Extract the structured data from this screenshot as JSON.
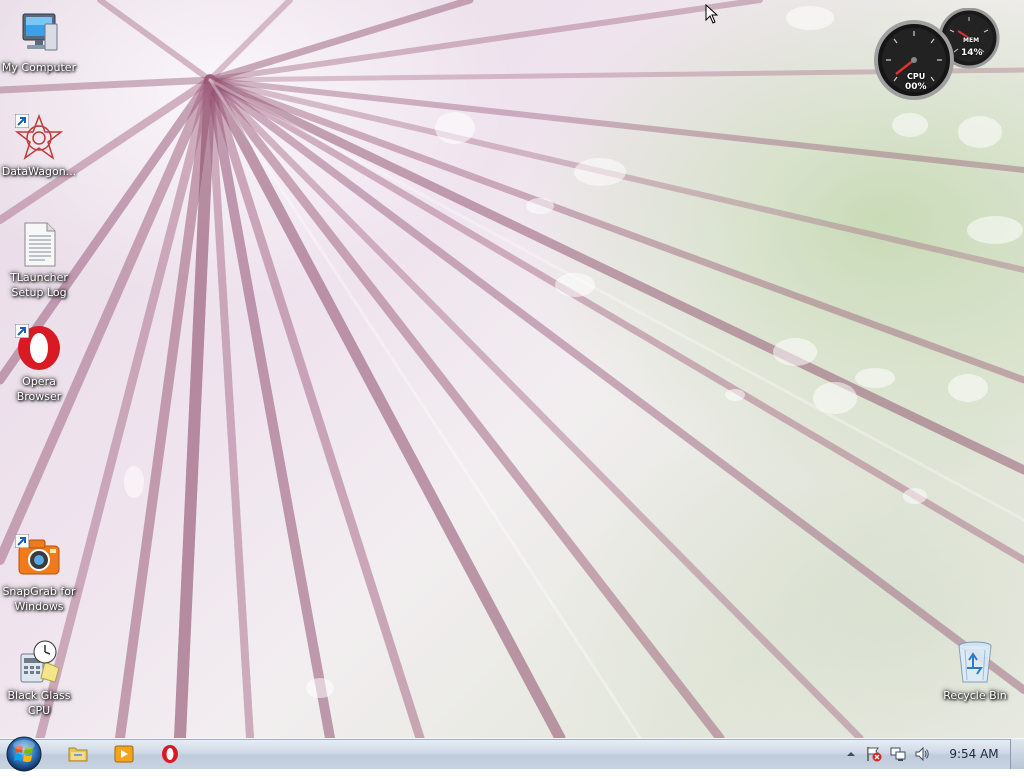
{
  "desktop": {
    "icons": [
      {
        "label": "My Computer",
        "icon": "computer-icon"
      },
      {
        "label": "DataWagon...",
        "icon": "datawagon-icon"
      },
      {
        "label": "TLauncher Setup Log",
        "icon": "text-document-icon"
      },
      {
        "label": "Opera Browser",
        "icon": "opera-icon"
      },
      {
        "label": "SnapGrab for Windows",
        "icon": "camera-icon"
      },
      {
        "label": "Black Glass CPU",
        "icon": "gadget-clock-icon"
      },
      {
        "label": "Recycle Bin",
        "icon": "recycle-bin-icon"
      }
    ]
  },
  "gadget": {
    "cpu_label": "CPU",
    "cpu_value": "00%",
    "mem_label": "MEM",
    "mem_value": "14%"
  },
  "taskbar": {
    "pinned": [
      {
        "name": "explorer",
        "icon": "folder-icon"
      },
      {
        "name": "media-player",
        "icon": "media-player-icon"
      },
      {
        "name": "opera",
        "icon": "opera-icon"
      }
    ],
    "tray_icons": [
      "show-hidden-icons-icon",
      "action-center-flag-icon",
      "network-icon",
      "volume-icon"
    ],
    "clock": "9:54 AM"
  },
  "colors": {
    "taskbar_top": "#e9eef5",
    "taskbar_bottom": "#bfcbdb",
    "opera_red": "#d81a25",
    "icon_label": "#ffffff"
  }
}
